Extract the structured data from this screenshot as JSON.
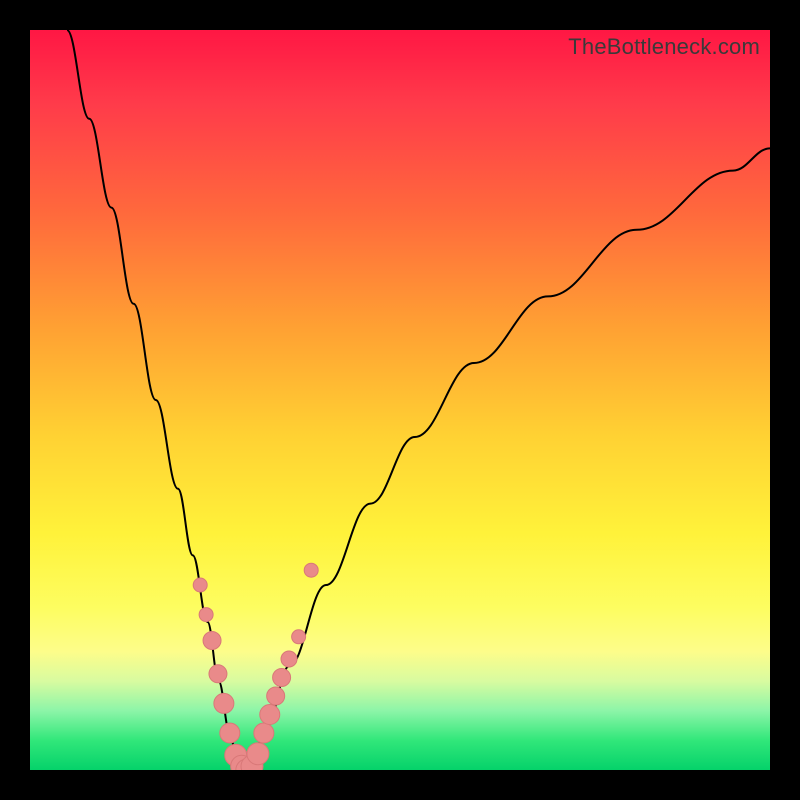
{
  "watermark": "TheBottleneck.com",
  "chart_data": {
    "type": "line",
    "title": "",
    "xlabel": "",
    "ylabel": "",
    "xlim": [
      0,
      100
    ],
    "ylim": [
      0,
      100
    ],
    "series": [
      {
        "name": "bottleneck-curve",
        "x": [
          5,
          8,
          11,
          14,
          17,
          20,
          22,
          24,
          25.5,
          27,
          28,
          29,
          30,
          32,
          35,
          40,
          46,
          52,
          60,
          70,
          82,
          95,
          100
        ],
        "y": [
          100,
          88,
          76,
          63,
          50,
          38,
          29,
          20,
          12,
          5,
          1,
          0,
          1,
          6,
          14,
          25,
          36,
          45,
          55,
          64,
          73,
          81,
          84
        ]
      }
    ],
    "markers": {
      "name": "highlighted-points",
      "x": [
        23.0,
        23.8,
        24.6,
        25.4,
        26.2,
        27.0,
        27.8,
        28.6,
        29.3,
        30.0,
        30.8,
        31.6,
        32.4,
        33.2,
        34.0,
        35.0,
        36.3,
        38.0
      ],
      "y": [
        25.0,
        21.0,
        17.5,
        13.0,
        9.0,
        5.0,
        2.0,
        0.5,
        0.0,
        0.5,
        2.2,
        5.0,
        7.5,
        10.0,
        12.5,
        15.0,
        18.0,
        27.0
      ],
      "r": [
        7,
        7,
        9,
        9,
        10,
        10,
        11,
        11,
        11,
        11,
        11,
        10,
        10,
        9,
        9,
        8,
        7,
        7
      ]
    },
    "gradient_stops": [
      {
        "pos": 0.0,
        "color": "#ff1744"
      },
      {
        "pos": 0.55,
        "color": "#ffd233"
      },
      {
        "pos": 0.85,
        "color": "#fdfd8a"
      },
      {
        "pos": 1.0,
        "color": "#05d26a"
      }
    ]
  }
}
